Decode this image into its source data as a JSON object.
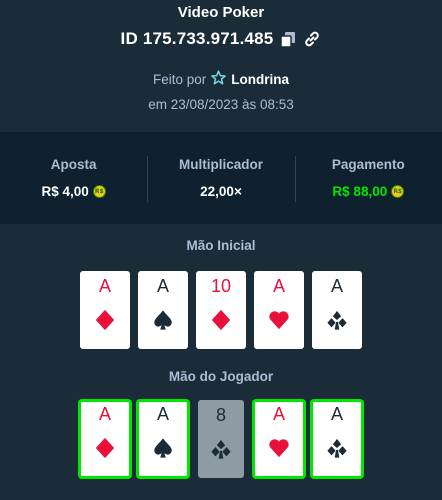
{
  "header": {
    "title": "Video Poker",
    "bet_id": "ID 175.733.971.485",
    "made_by_prefix": "Feito por",
    "username": "Londrina",
    "date": "em 23/08/2023 às 08:53"
  },
  "stats": {
    "bet_label": "Aposta",
    "bet_value": "R$ 4,00",
    "multiplier_label": "Multiplicador",
    "multiplier_value": "22,00×",
    "payout_label": "Pagamento",
    "payout_value": "R$ 88,00",
    "coin_text": "R$"
  },
  "initial_hand": {
    "label": "Mão Inicial",
    "cards": [
      {
        "rank": "A",
        "suit": "diamond",
        "color": "red"
      },
      {
        "rank": "A",
        "suit": "spade",
        "color": "black"
      },
      {
        "rank": "10",
        "suit": "diamond",
        "color": "red"
      },
      {
        "rank": "A",
        "suit": "heart",
        "color": "red"
      },
      {
        "rank": "A",
        "suit": "club",
        "color": "black"
      }
    ]
  },
  "player_hand": {
    "label": "Mão do Jogador",
    "cards": [
      {
        "rank": "A",
        "suit": "diamond",
        "color": "red",
        "held": true
      },
      {
        "rank": "A",
        "suit": "spade",
        "color": "black",
        "held": true
      },
      {
        "rank": "8",
        "suit": "club",
        "color": "black",
        "held": false
      },
      {
        "rank": "A",
        "suit": "heart",
        "color": "red",
        "held": true
      },
      {
        "rank": "A",
        "suit": "club",
        "color": "black",
        "held": true
      }
    ]
  },
  "colors": {
    "background": "#1a2c38",
    "panel": "#0f212e",
    "muted_text": "#b1bad3",
    "win_green": "#00e701",
    "red_suit": "#e9113c"
  }
}
